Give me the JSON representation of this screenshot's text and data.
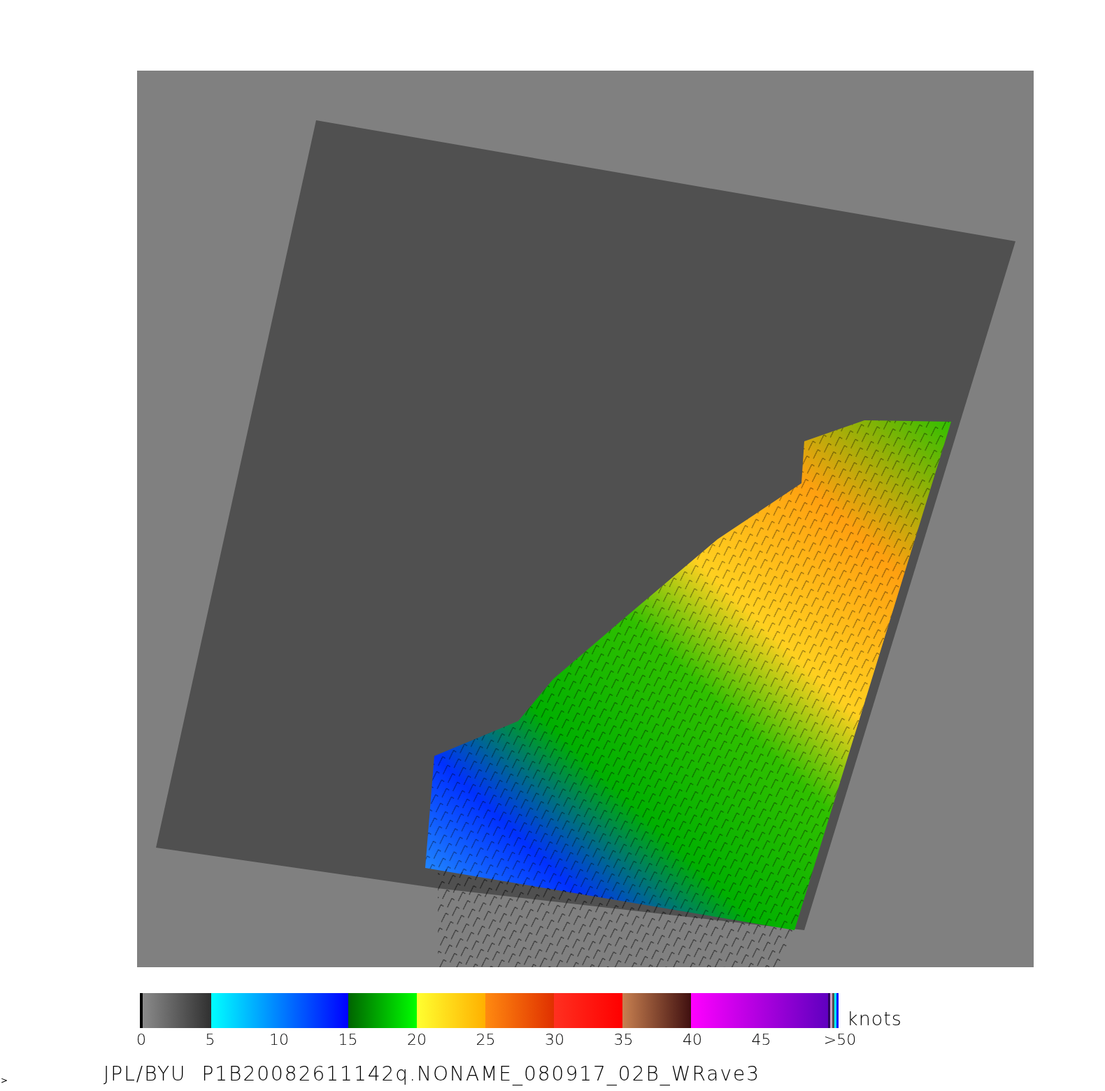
{
  "colorbar": {
    "ticks": [
      "0",
      "5",
      "10",
      "15",
      "20",
      "25",
      "30",
      "35",
      "40",
      "45",
      ">50"
    ],
    "unit": "knots"
  },
  "caption": "JPL/BYU  P1B20082611142q.NONAME_080917_02B_WRave3",
  "edge_mark": ">"
}
